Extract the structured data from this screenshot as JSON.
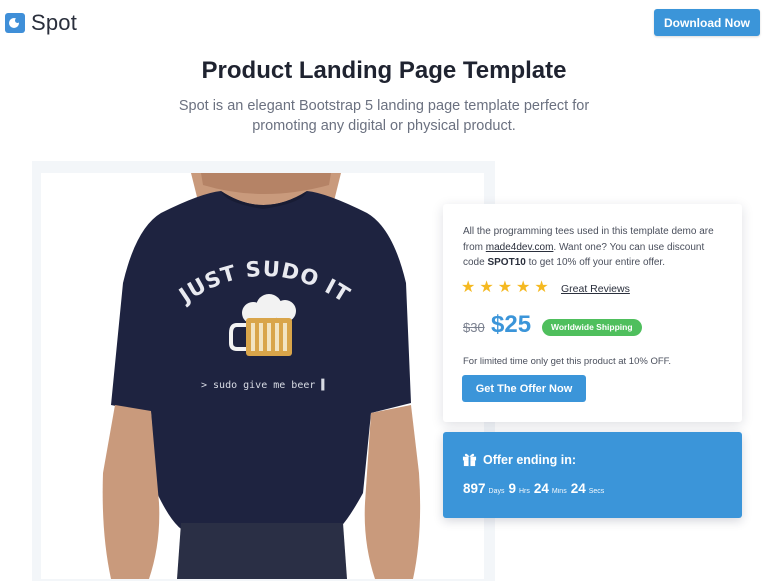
{
  "navbar": {
    "brand_name": "Spot",
    "download_label": "Download Now"
  },
  "hero": {
    "title": "Product Landing Page Template",
    "subtitle": "Spot is an elegant Bootstrap 5 landing page template perfect for promoting any digital or physical product."
  },
  "product_image": {
    "shirt_text": "JUST SUDO IT",
    "terminal_text": "> sudo give me beer ▌"
  },
  "offer_card": {
    "desc_part1": "All the programming tees used in this template demo are from ",
    "desc_link": "made4dev.com",
    "desc_part2": ". Want one? You can use discount code ",
    "desc_code": "SPOT10",
    "desc_part3": " to get 10% off your entire offer.",
    "rating": 5,
    "reviews_label": "Great Reviews",
    "old_price": "$30",
    "new_price": "$25",
    "shipping_badge": "Worldwide Shipping",
    "limited_text": "For limited time only get this product at 10% OFF.",
    "cta_label": "Get The Offer Now"
  },
  "countdown": {
    "title": "Offer ending in:",
    "days": "897",
    "days_label": "Days",
    "hours": "9",
    "hours_label": "Hrs",
    "mins": "24",
    "mins_label": "Mins",
    "secs": "24",
    "secs_label": "Secs"
  },
  "colors": {
    "accent": "#3b95d9",
    "badge_green": "#4fbf5d",
    "star": "#f5b921",
    "shirt_navy": "#1e2340"
  },
  "icons": {
    "logo": "spot-logo-icon",
    "star": "star-icon",
    "gift": "gift-icon"
  }
}
